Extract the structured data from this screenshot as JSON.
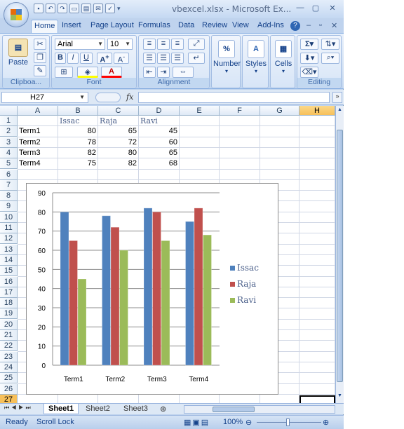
{
  "window": {
    "title": "vbexcel.xlsx - Microsoft Ex..."
  },
  "tabs": [
    "Home",
    "Insert",
    "Page Layout",
    "Formulas",
    "Data",
    "Review",
    "View",
    "Add-Ins"
  ],
  "ribbon": {
    "clipboard": {
      "paste_label": "Paste",
      "group_label": "Clipboa..."
    },
    "font": {
      "font_name": "Arial",
      "font_size": "10",
      "group_label": "Font",
      "bold": "B",
      "italic": "I",
      "underline": "U"
    },
    "alignment": {
      "group_label": "Alignment"
    },
    "number": {
      "label": "Number",
      "symbol": "%"
    },
    "styles": {
      "label": "Styles"
    },
    "cells": {
      "label": "Cells"
    },
    "editing": {
      "group_label": "Editing"
    }
  },
  "formula_bar": {
    "name_box": "H27",
    "fx": "fx",
    "value": ""
  },
  "columns": [
    "A",
    "B",
    "C",
    "D",
    "E",
    "F",
    "G",
    "H"
  ],
  "selected_column": "H",
  "rows": [
    "1",
    "2",
    "3",
    "4",
    "5",
    "6",
    "7",
    "8",
    "9",
    "10",
    "11",
    "12",
    "13",
    "14",
    "15",
    "16",
    "17",
    "18",
    "19",
    "20",
    "21",
    "22",
    "23",
    "24",
    "25",
    "26",
    "27"
  ],
  "selected_row": "27",
  "table": {
    "headers": [
      "Issac",
      "Raja",
      "Ravi"
    ],
    "rows": [
      {
        "label": "Term1",
        "values": [
          "80",
          "65",
          "45"
        ]
      },
      {
        "label": "Term2",
        "values": [
          "78",
          "72",
          "60"
        ]
      },
      {
        "label": "Term3",
        "values": [
          "82",
          "80",
          "65"
        ]
      },
      {
        "label": "Term4",
        "values": [
          "75",
          "82",
          "68"
        ]
      }
    ]
  },
  "chart_data": {
    "type": "bar",
    "categories": [
      "Term1",
      "Term2",
      "Term3",
      "Term4"
    ],
    "series": [
      {
        "name": "Issac",
        "values": [
          80,
          78,
          82,
          75
        ],
        "color": "#4f81bd"
      },
      {
        "name": "Raja",
        "values": [
          65,
          72,
          80,
          82
        ],
        "color": "#c0504d"
      },
      {
        "name": "Ravi",
        "values": [
          45,
          60,
          65,
          68
        ],
        "color": "#9bbb59"
      }
    ],
    "ylim": [
      0,
      90
    ],
    "yticks": [
      "0",
      "10",
      "20",
      "30",
      "40",
      "50",
      "60",
      "70",
      "80",
      "90"
    ],
    "grid": true,
    "legend": "right"
  },
  "sheets": [
    "Sheet1",
    "Sheet2",
    "Sheet3"
  ],
  "active_sheet": "Sheet1",
  "status": {
    "ready": "Ready",
    "scroll_lock": "Scroll Lock",
    "zoom": "100%"
  }
}
